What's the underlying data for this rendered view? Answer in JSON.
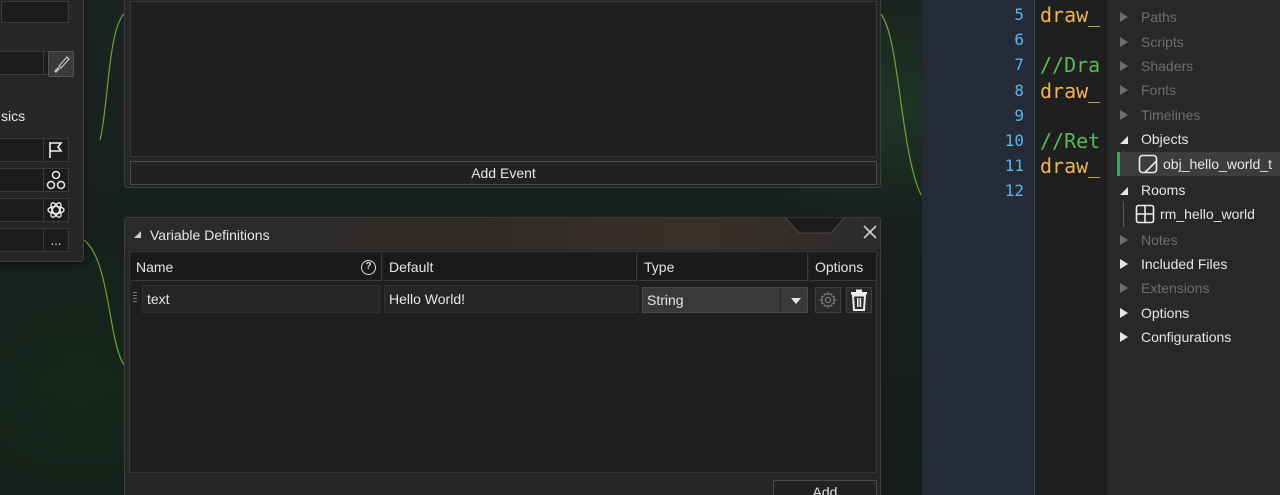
{
  "events_panel": {
    "add_event_label": "Add Event"
  },
  "properties_panel": {
    "partial_label": "sics",
    "more_label": "...",
    "row_more_label": "..."
  },
  "variable_definitions": {
    "title": "Variable Definitions",
    "close_glyph": "X",
    "columns": [
      "Name",
      "Default",
      "Type",
      "Options"
    ],
    "help_glyph": "?",
    "rows": [
      {
        "name": "text",
        "default": "Hello World!",
        "type": "String"
      }
    ],
    "add_label": "Add"
  },
  "code_editor": {
    "lines": [
      {
        "number": "5",
        "text": "draw_",
        "kind": "fn"
      },
      {
        "number": "6",
        "text": "",
        "kind": "fn"
      },
      {
        "number": "7",
        "text": "//Dra",
        "kind": "comment"
      },
      {
        "number": "8",
        "text": "draw_",
        "kind": "fn"
      },
      {
        "number": "9",
        "text": "",
        "kind": "fn"
      },
      {
        "number": "10",
        "text": "//Ret",
        "kind": "comment"
      },
      {
        "number": "11",
        "text": "draw_",
        "kind": "fn"
      },
      {
        "number": "12",
        "text": "",
        "kind": "fn"
      }
    ],
    "colors": {
      "line_number": "#59b6f0",
      "function": "#f2b355",
      "comment": "#5db85d"
    }
  },
  "asset_browser": {
    "items": [
      {
        "label": "Paths",
        "state": "collapsed",
        "dim": true
      },
      {
        "label": "Scripts",
        "state": "collapsed",
        "dim": true
      },
      {
        "label": "Shaders",
        "state": "collapsed",
        "dim": true
      },
      {
        "label": "Fonts",
        "state": "collapsed",
        "dim": true
      },
      {
        "label": "Timelines",
        "state": "collapsed",
        "dim": true
      },
      {
        "label": "Objects",
        "state": "expanded",
        "dim": false
      },
      {
        "label": "Rooms",
        "state": "expanded",
        "dim": false
      },
      {
        "label": "Notes",
        "state": "collapsed",
        "dim": true
      },
      {
        "label": "Included Files",
        "state": "collapsed",
        "dim": false
      },
      {
        "label": "Extensions",
        "state": "collapsed",
        "dim": true
      },
      {
        "label": "Options",
        "state": "collapsed",
        "dim": false
      },
      {
        "label": "Configurations",
        "state": "collapsed",
        "dim": false
      }
    ],
    "object_child": "obj_hello_world_t",
    "room_child": "rm_hello_world",
    "selection_accent": "#3ea06a"
  }
}
